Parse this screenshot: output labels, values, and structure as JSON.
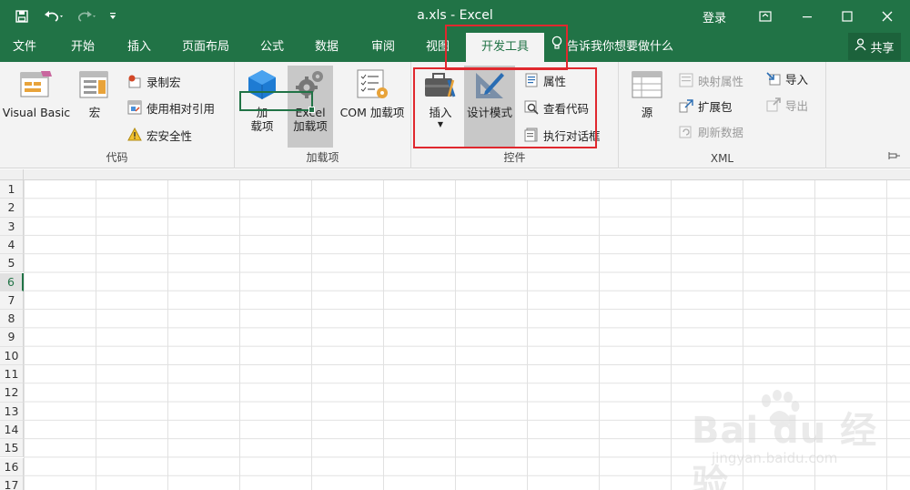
{
  "titlebar": {
    "title": "a.xls  -  Excel",
    "login": "登录",
    "quick_access": [
      "save-icon",
      "undo-icon",
      "redo-icon",
      "customize-icon"
    ]
  },
  "tabs": [
    "文件",
    "开始",
    "插入",
    "页面布局",
    "公式",
    "数据",
    "审阅",
    "视图",
    "开发工具"
  ],
  "active_tab": "开发工具",
  "tell_me": "告诉我你想要做什么",
  "share": "共享",
  "ribbon": {
    "code": {
      "label": "代码",
      "visual_basic": "Visual Basic",
      "macro": "宏",
      "record_macro": "录制宏",
      "relative_ref": "使用相对引用",
      "macro_security": "宏安全性"
    },
    "addins": {
      "label": "加载项",
      "addin_line1": "加",
      "addin_line2": "载项",
      "excel_addin_line1": "Excel",
      "excel_addin_line2": "加载项",
      "com_addin": "COM 加载项"
    },
    "controls": {
      "label": "控件",
      "insert": "插入",
      "design_mode": "设计模式",
      "properties": "属性",
      "view_code": "查看代码",
      "run_dialog": "执行对话框"
    },
    "xml": {
      "label": "XML",
      "source": "源",
      "map_props": "映射属性",
      "expansion": "扩展包",
      "refresh": "刷新数据",
      "import": "导入",
      "export": "导出"
    }
  },
  "grid": {
    "rows": [
      "1",
      "2",
      "3",
      "4",
      "5",
      "6",
      "7",
      "8",
      "9",
      "10",
      "11",
      "12",
      "13",
      "14",
      "15",
      "16",
      "17"
    ],
    "selected_row": "6"
  },
  "watermark": {
    "main": "Bai du 经验",
    "sub": "jingyan.baidu.com"
  },
  "colors": {
    "brand": "#217346",
    "annotation": "#e0282e"
  }
}
